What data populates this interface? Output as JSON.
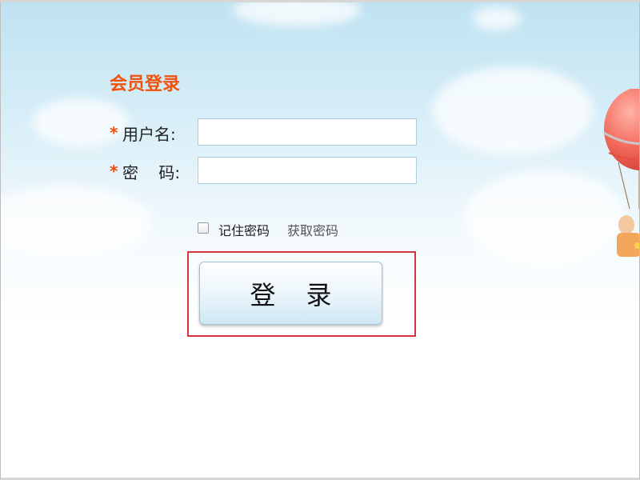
{
  "form": {
    "title": "会员登录",
    "required_mark": "*",
    "username_label": "用户名:",
    "password_label": "密    码:",
    "username_value": "",
    "password_value": ""
  },
  "options": {
    "remember_label": "记住密码",
    "remember_checked": false,
    "forgot_label": "获取密码"
  },
  "actions": {
    "login_label": "登录"
  },
  "colors": {
    "title": "#f0520c",
    "required": "#e94d0f",
    "highlight_border": "#d7343f"
  },
  "decoration": {
    "balloon": "hot-air-balloon-illustration"
  }
}
